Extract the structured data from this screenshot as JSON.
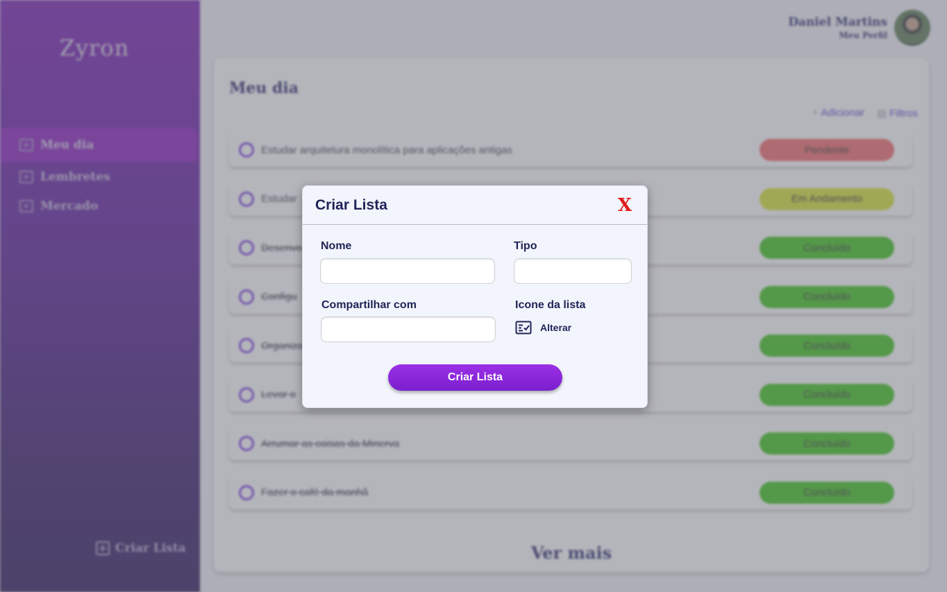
{
  "app": {
    "logo": "Zyron"
  },
  "sidebar": {
    "items": [
      {
        "label": "Meu dia",
        "active": true
      },
      {
        "label": "Lembretes",
        "active": false
      },
      {
        "label": "Mercado",
        "active": false
      }
    ],
    "create_label": "Criar Lista"
  },
  "header": {
    "user_name": "Daniel Martins",
    "profile_link": "Meu Perfil"
  },
  "main": {
    "title": "Meu dia",
    "add_label": "Adicionar",
    "filters_label": "Filtros",
    "see_more": "Ver mais",
    "tasks": [
      {
        "text": "Estudar arquitetura monolítica para aplicações antigas",
        "status": "Pendente",
        "done": false
      },
      {
        "text": "Estudar",
        "status": "Em Andamento",
        "done": false
      },
      {
        "text": "Desenvo",
        "status": "Concluído",
        "done": true
      },
      {
        "text": "Configu",
        "status": "Concluído",
        "done": true
      },
      {
        "text": "Organiza",
        "status": "Concluído",
        "done": true
      },
      {
        "text": "Levar o",
        "status": "Concluído",
        "done": true
      },
      {
        "text": "Arrumar as coisas da Minerva",
        "status": "Concluído",
        "done": true
      },
      {
        "text": "Fazer o café da manhã",
        "status": "Concluído",
        "done": true
      }
    ]
  },
  "status_colors": {
    "Pendente": "#f26a6a",
    "Em Andamento": "#d8e433",
    "Concluído": "#3fc41a"
  },
  "modal": {
    "title": "Criar Lista",
    "close_glyph": "X",
    "name_label": "Nome",
    "name_value": "",
    "type_label": "Tipo",
    "type_value": "",
    "share_label": "Compartilhar com",
    "share_value": "",
    "icon_label": "Icone da lista",
    "icon_name": "checklist-icon",
    "icon_action": "Alterar",
    "submit_label": "Criar Lista"
  }
}
